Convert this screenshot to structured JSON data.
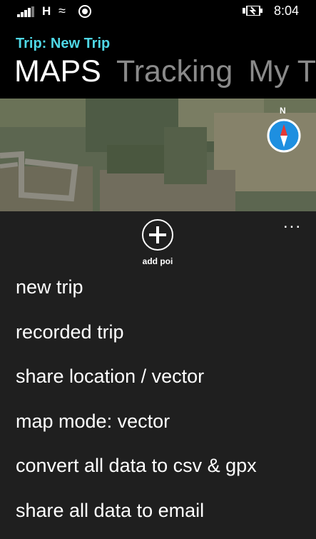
{
  "status_bar": {
    "network": "H",
    "time": "8:04"
  },
  "header": {
    "trip_title": "Trip: New Trip",
    "pivot_items": [
      "MAPS",
      "Tracking",
      "My Tr"
    ]
  },
  "map": {
    "compass_label": "N",
    "compass_icon": "compass-icon"
  },
  "app_bar": {
    "add_poi_label": "add poi",
    "more_label": "..."
  },
  "menu": {
    "items": [
      "new trip",
      "recorded trip",
      "share location / vector",
      "map mode: vector",
      "convert all data to csv & gpx",
      "share all data to email"
    ]
  }
}
